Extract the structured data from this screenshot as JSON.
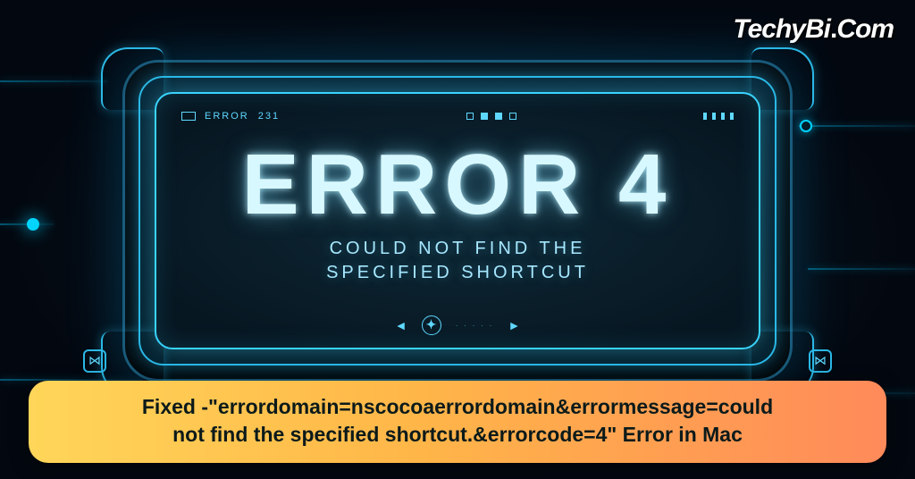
{
  "logo": {
    "brand": "TechyBi",
    "dot": ".",
    "tld": "Com"
  },
  "device": {
    "topbar": {
      "error_label": "ERROR",
      "error_code_small": "231"
    },
    "error_title": "ERROR 4",
    "error_subtitle_line1": "COULD NOT FIND THE",
    "error_subtitle_line2": "SPECIFIED SHORTCUT",
    "plus_glyph": "✦",
    "arrow_left": "◄",
    "arrow_right": "►",
    "side_glyph_left": "⋈",
    "side_glyph_right": "⋈"
  },
  "caption": {
    "line1": "Fixed -\"errordomain=nscocoaerrordomain&errormessage=could",
    "line2": "not find the specified shortcut.&errorcode=4\" Error in Mac"
  }
}
